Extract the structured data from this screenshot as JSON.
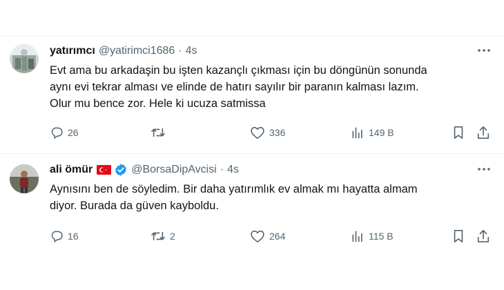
{
  "colors": {
    "text_primary": "#0f1419",
    "text_secondary": "#536471",
    "verified_blue": "#1d9bf0",
    "flag_red": "#e30a17",
    "divider": "#eff3f4"
  },
  "tweets": [
    {
      "display_name": "yatırımcı",
      "handle": "@yatirimci1686",
      "separator": "·",
      "time": "4s",
      "badges": [],
      "text_lines": [
        "Evt ama bu arkadaşin bu işten kazançlı çıkması için bu döngünün sonunda",
        "aynı evi tekrar alması ve elinde de hatırı sayılır bir paranın kalması lazım.",
        "Olur mu bence zor. Hele ki ucuza satmissa"
      ],
      "actions": {
        "reply": "26",
        "repost": "",
        "like": "336",
        "views": "149 B"
      },
      "icons": [
        "reply-icon",
        "repost-icon",
        "like-icon",
        "views-icon",
        "bookmark-icon",
        "share-icon",
        "more-icon"
      ]
    },
    {
      "display_name": "ali ömür",
      "handle": "@BorsaDipAvcisi",
      "separator": "·",
      "time": "4s",
      "badges": [
        "turkey-flag-icon",
        "verified-badge-icon"
      ],
      "text_lines": [
        "Aynısını ben de söyledim. Bir daha yatırımlık ev almak mı hayatta almam",
        "diyor. Burada da güven kayboldu."
      ],
      "actions": {
        "reply": "16",
        "repost": "2",
        "like": "264",
        "views": "115 B"
      },
      "icons": [
        "reply-icon",
        "repost-icon",
        "like-icon",
        "views-icon",
        "bookmark-icon",
        "share-icon",
        "more-icon"
      ]
    }
  ]
}
